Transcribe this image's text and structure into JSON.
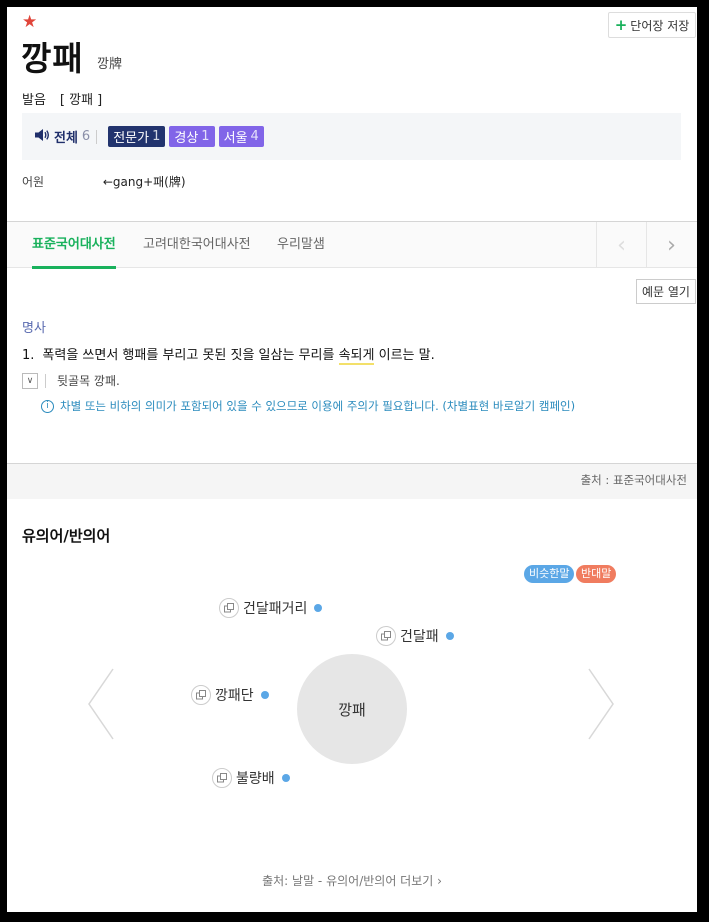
{
  "header": {
    "star_icon": "★",
    "save_label": "단어장 저장",
    "word": "깡패",
    "hanja": "깡牌",
    "pronunciation_label": "발음",
    "pronunciation_value": "[ 깡패 ]"
  },
  "audio": {
    "all_label": "전체",
    "all_count": "6",
    "tags": [
      {
        "label": "전문가",
        "count": "1"
      },
      {
        "label": "경상",
        "count": "1"
      },
      {
        "label": "서울",
        "count": "4"
      }
    ]
  },
  "etymology": {
    "label": "어원",
    "value": "←gang+패(牌)"
  },
  "tabs": [
    {
      "label": "표준국어대사전",
      "active": true
    },
    {
      "label": "고려대한국어대사전",
      "active": false
    },
    {
      "label": "우리말샘",
      "active": false
    }
  ],
  "entry": {
    "example_toggle": "예문 열기",
    "pos": "명사",
    "def_number": "1.",
    "def_before": "폭력을 쓰면서 행패를 부리고 못된 짓을 일삼는 무리를 ",
    "def_highlight": "속되게",
    "def_after": " 이르는 말.",
    "related": "뒷골목 깡패.",
    "notice": "차별 또는 비하의 의미가 포함되어 있을 수 있으므로 이용에 주의가 필요합니다. (차별표현 바로알기 캠페인)",
    "source": "출처 : 표준국어대사전"
  },
  "synonyms": {
    "title": "유의어/반의어",
    "legend_similar": "비슷한말",
    "legend_opposite": "반대말",
    "center": "깡패",
    "nodes": [
      "건달패거리",
      "건달패",
      "깡패단",
      "불량배"
    ],
    "source": "출처: 날말 - 유의어/반의어 더보기 ›"
  },
  "colors": {
    "accent_green": "#19b15c",
    "similar_blue": "#5ba7e6",
    "opposite_orange": "#f07c5f",
    "expert_tag": "#22346e",
    "region_tag": "#8165e8"
  }
}
